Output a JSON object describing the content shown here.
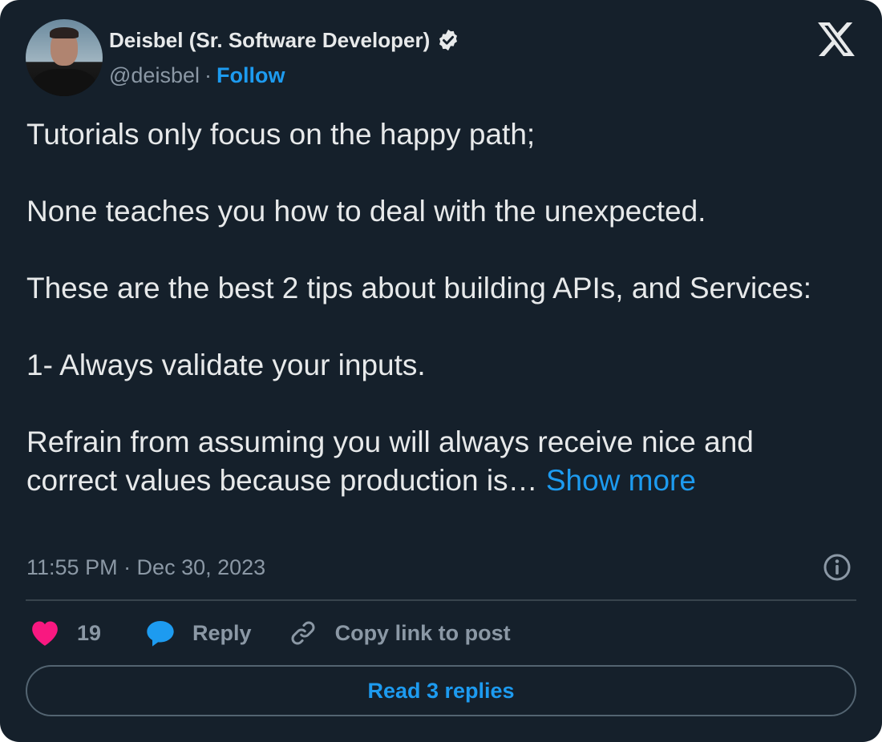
{
  "author": {
    "name": "Deisbel (Sr. Software Developer)",
    "handle": "@deisbel",
    "separator": "·",
    "follow_label": "Follow",
    "verified_icon": "verified-badge-icon"
  },
  "brand": {
    "logo": "x-logo-icon"
  },
  "tweet": {
    "paragraphs": [
      "Tutorials only focus on the happy path;",
      "None teaches you how to deal with the unexpected.",
      "These are the best 2 tips about building APIs, and Services:",
      "1- Always validate your inputs.",
      "Refrain from assuming you will always receive nice and correct values because production is…"
    ],
    "show_more_label": "Show more"
  },
  "meta": {
    "timestamp": "11:55 PM · Dec 30, 2023",
    "info_icon": "info-icon"
  },
  "actions": {
    "like_count": "19",
    "reply_label": "Reply",
    "copy_link_label": "Copy link to post"
  },
  "read_replies_label": "Read 3 replies",
  "colors": {
    "background": "#15202b",
    "text": "#e7e9ea",
    "muted": "#8b98a5",
    "accent": "#1d9bf0",
    "heart": "#f91880",
    "divider": "#38444d"
  }
}
